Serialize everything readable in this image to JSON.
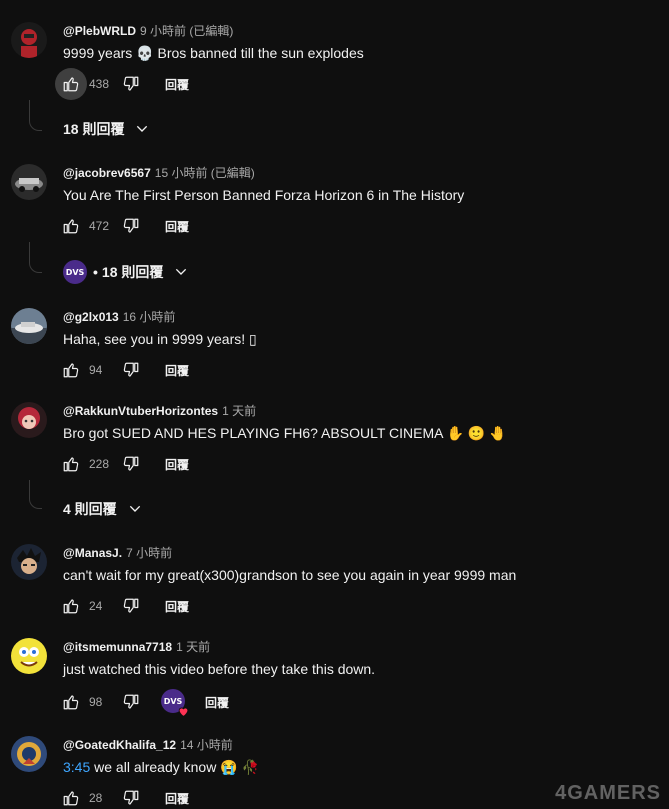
{
  "comments": [
    {
      "handle": "@PlebWRLD",
      "time": "9 小時前 (已編輯)",
      "text": "9999 years 💀 Bros banned till the sun explodes",
      "likes": "438",
      "reply_label": "回覆",
      "replies": "18 則回覆"
    },
    {
      "handle": "@jacobrev6567",
      "time": "15 小時前 (已編輯)",
      "text": "You Are The First Person Banned Forza Horizon 6 in The History",
      "likes": "472",
      "reply_label": "回覆",
      "replies_creator_badge": "DVS",
      "replies_separator": "•",
      "replies": "18 則回覆"
    },
    {
      "handle": "@g2lx013",
      "time": "16 小時前",
      "text": "Haha, see you in 9999 years! ▯",
      "likes": "94",
      "reply_label": "回覆"
    },
    {
      "handle": "@RakkunVtuberHorizontes",
      "time": "1 天前",
      "text": "Bro got SUED AND HES PLAYING FH6? ABSOULT CINEMA ✋ 🙂 🤚",
      "likes": "228",
      "reply_label": "回覆",
      "replies": "4 則回覆"
    },
    {
      "handle": "@ManasJ.",
      "time": "7 小時前",
      "text": "can't wait for my great(x300)grandson  to see you again in year 9999 man",
      "likes": "24",
      "reply_label": "回覆"
    },
    {
      "handle": "@itsmemunna7718",
      "time": "1 天前",
      "text": "just watched this video before they take this down.",
      "likes": "98",
      "reply_label": "回覆",
      "creator_heart_badge": "DVS"
    },
    {
      "handle": "@GoatedKhalifa_12",
      "time": "14 小時前",
      "timestamp_link": "3:45",
      "text": " we all already know 😭 🥀",
      "likes": "28",
      "reply_label": "回覆"
    }
  ],
  "watermark": "4GAMERS",
  "colors": {
    "background": "#0f0f0f",
    "link": "#3ea6ff",
    "secondary_text": "#aaaaaa",
    "creator_badge": "#4a2b8a",
    "heart": "#ff3355"
  }
}
